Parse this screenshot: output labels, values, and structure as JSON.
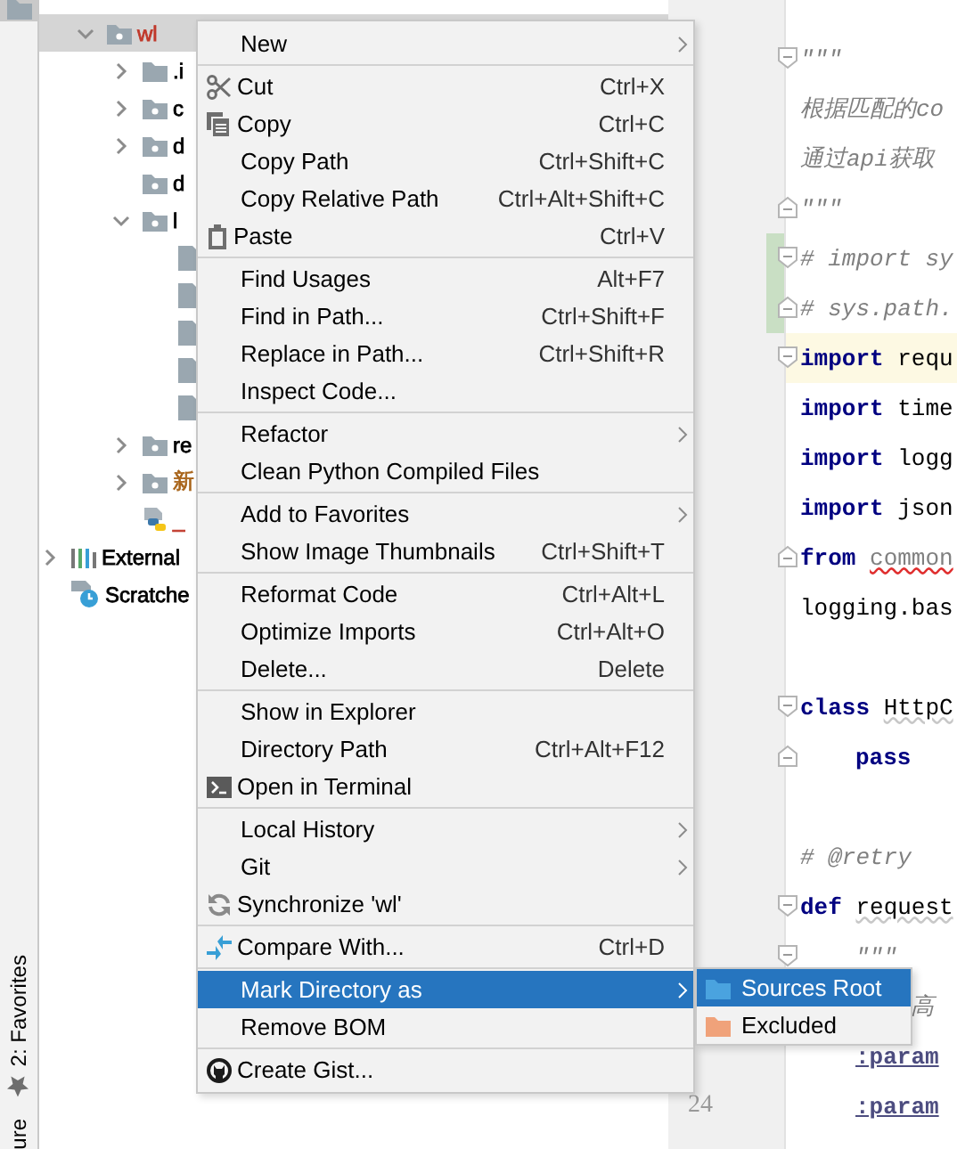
{
  "tool_strip": {
    "top_button": {
      "selected": true
    },
    "bottom_buttons": [
      {
        "label": "2: Favorites",
        "kind": "favorites"
      },
      {
        "label": "ure",
        "kind": "structure"
      }
    ]
  },
  "project_tree": {
    "items": [
      {
        "label": "wl",
        "kind": "package",
        "expanded": true,
        "selected": true,
        "color": "#c0392b",
        "children": [
          {
            "label": ".i",
            "kind": "folder",
            "expanded": false,
            "selected": false,
            "color": "#000000"
          },
          {
            "label": "c",
            "kind": "package",
            "expanded": false,
            "selected": false,
            "color": "#000000"
          },
          {
            "label": "d",
            "kind": "package",
            "expanded": false,
            "selected": false,
            "color": "#000000"
          },
          {
            "label": "d",
            "kind": "package",
            "selected": false,
            "color": "#000000"
          },
          {
            "label": "l",
            "kind": "package",
            "expanded": true,
            "selected": false,
            "color": "#000000",
            "children": [
              {
                "kind": "file",
                "selected": false
              },
              {
                "kind": "file",
                "selected": false
              },
              {
                "kind": "file",
                "selected": false
              },
              {
                "kind": "file",
                "selected": false
              },
              {
                "kind": "file",
                "selected": false
              }
            ]
          },
          {
            "label": "re",
            "kind": "package",
            "expanded": false,
            "selected": false,
            "color": "#000000"
          },
          {
            "label": "新",
            "kind": "package",
            "expanded": false,
            "selected": false,
            "color": "#a8641a"
          },
          {
            "label": "_",
            "kind": "python",
            "selected": false,
            "color": "#c0392b"
          }
        ]
      }
    ],
    "roots": [
      {
        "label": "External",
        "kind": "libraries",
        "expanded": false,
        "selected": false,
        "color": "#000000"
      },
      {
        "label": "Scratche",
        "kind": "scratches",
        "selected": false,
        "color": "#000000"
      }
    ]
  },
  "editor": {
    "lines": [
      {
        "kind": "top",
        "tokens": [
          {
            "text": "\"\"\"",
            "kind": "docstring"
          }
        ],
        "fold_start": true,
        "fold_end": false,
        "current": false,
        "changed": false
      },
      {
        "kind": "top",
        "tokens": [
          {
            "text": "根据匹配的co",
            "kind": "docstring"
          }
        ],
        "fold_start": false,
        "fold_end": false,
        "current": false,
        "changed": false
      },
      {
        "kind": "top",
        "tokens": [
          {
            "text": "通过api获取",
            "kind": "docstring"
          }
        ],
        "fold_start": false,
        "fold_end": false,
        "current": false,
        "changed": false
      },
      {
        "kind": "top",
        "tokens": [
          {
            "text": "\"\"\"",
            "kind": "docstring"
          }
        ],
        "fold_start": false,
        "fold_end": true,
        "current": false,
        "changed": false
      },
      {
        "kind": "top",
        "tokens": [
          {
            "text": "# import sy",
            "kind": "comment"
          }
        ],
        "fold_start": true,
        "fold_end": false,
        "current": false,
        "changed": true
      },
      {
        "kind": "top",
        "tokens": [
          {
            "text": "# sys.path.",
            "kind": "comment"
          }
        ],
        "fold_start": false,
        "fold_end": true,
        "current": false,
        "changed": true
      },
      {
        "kind": "top",
        "tokens": [
          {
            "text": "import",
            "kind": "keyword"
          },
          {
            "text": "requ",
            "kind": "plain"
          }
        ],
        "fold_start": true,
        "fold_end": false,
        "current": true,
        "changed": false
      },
      {
        "kind": "top",
        "tokens": [
          {
            "text": "import",
            "kind": "keyword"
          },
          {
            "text": "time",
            "kind": "plain"
          }
        ],
        "fold_start": false,
        "fold_end": false,
        "current": false,
        "changed": false
      },
      {
        "kind": "top",
        "tokens": [
          {
            "text": "import",
            "kind": "keyword"
          },
          {
            "text": "logg",
            "kind": "plain"
          }
        ],
        "fold_start": false,
        "fold_end": false,
        "current": false,
        "changed": false
      },
      {
        "kind": "top",
        "tokens": [
          {
            "text": "import",
            "kind": "keyword"
          },
          {
            "text": "json",
            "kind": "plain"
          }
        ],
        "fold_start": false,
        "fold_end": false,
        "current": false,
        "changed": false
      },
      {
        "kind": "top",
        "tokens": [
          {
            "text": "from",
            "kind": "keyword"
          },
          {
            "text": "common",
            "kind": "error"
          }
        ],
        "fold_start": false,
        "fold_end": true,
        "current": false,
        "changed": false
      },
      {
        "kind": "top",
        "tokens": [
          {
            "text": "logging.bas",
            "kind": "plain"
          }
        ],
        "fold_start": false,
        "fold_end": false,
        "current": false,
        "changed": false
      },
      {
        "kind": "top",
        "fold_start": false,
        "fold_end": false,
        "current": false,
        "changed": false
      },
      {
        "kind": "top",
        "tokens": [
          {
            "text": "class",
            "kind": "keyword"
          },
          {
            "text": "HttpC",
            "kind": "weak"
          }
        ],
        "fold_start": true,
        "fold_end": false,
        "current": false,
        "changed": false
      },
      {
        "kind": "block",
        "tokens": [
          {
            "text": "pass",
            "kind": "keyword"
          }
        ],
        "fold_start": false,
        "fold_end": true,
        "current": false,
        "changed": false
      },
      {
        "kind": "top",
        "fold_start": false,
        "fold_end": false,
        "current": false,
        "changed": false
      },
      {
        "kind": "top",
        "tokens": [
          {
            "text": "# @retry",
            "kind": "comment"
          }
        ],
        "fold_start": false,
        "fold_end": false,
        "current": false,
        "changed": false
      },
      {
        "kind": "top",
        "tokens": [
          {
            "text": "def",
            "kind": "keyword"
          },
          {
            "text": "request",
            "kind": "weak"
          }
        ],
        "fold_start": true,
        "fold_end": false,
        "current": false,
        "changed": false
      },
      {
        "kind": "block",
        "tokens": [
          {
            "text": "\"\"\"",
            "kind": "docstring"
          }
        ],
        "fold_start": true,
        "fold_end": false,
        "current": false,
        "changed": false
      },
      {
        "kind": "doc",
        "tokens": [
          {
            "text": "高",
            "kind": "docstring"
          }
        ],
        "fold_start": false,
        "fold_end": false,
        "current": false,
        "changed": false
      },
      {
        "kind": "block",
        "tokens": [
          {
            "text": ":param",
            "kind": "doctag"
          }
        ],
        "fold_start": false,
        "fold_end": false,
        "current": false,
        "changed": false
      },
      {
        "kind": "block",
        "number": "24",
        "tokens": [
          {
            "text": ":param",
            "kind": "doctag"
          }
        ],
        "fold_start": false,
        "fold_end": false,
        "current": false,
        "changed": false
      }
    ]
  },
  "context_menu": {
    "groups": [
      {
        "items": [
          {
            "label": "New",
            "kind": "plain",
            "submenu": true,
            "selected": false
          }
        ]
      },
      {
        "items": [
          {
            "label": "Cut",
            "shortcut": "Ctrl+X",
            "kind": "scissors",
            "submenu": false,
            "selected": false
          },
          {
            "label": "Copy",
            "shortcut": "Ctrl+C",
            "kind": "copy",
            "submenu": false,
            "selected": false
          },
          {
            "label": "Copy Path",
            "shortcut": "Ctrl+Shift+C",
            "kind": "plain",
            "submenu": false,
            "selected": false
          },
          {
            "label": "Copy Relative Path",
            "shortcut": "Ctrl+Alt+Shift+C",
            "kind": "plain",
            "submenu": false,
            "selected": false
          },
          {
            "label": "Paste",
            "shortcut": "Ctrl+V",
            "kind": "clipboard",
            "submenu": false,
            "selected": false
          }
        ]
      },
      {
        "items": [
          {
            "label": "Find Usages",
            "shortcut": "Alt+F7",
            "kind": "plain",
            "submenu": false,
            "selected": false
          },
          {
            "label": "Find in Path...",
            "shortcut": "Ctrl+Shift+F",
            "kind": "plain",
            "submenu": false,
            "selected": false
          },
          {
            "label": "Replace in Path...",
            "shortcut": "Ctrl+Shift+R",
            "kind": "plain",
            "submenu": false,
            "selected": false
          },
          {
            "label": "Inspect Code...",
            "kind": "plain",
            "submenu": false,
            "selected": false
          }
        ]
      },
      {
        "items": [
          {
            "label": "Refactor",
            "kind": "plain",
            "submenu": true,
            "selected": false
          },
          {
            "label": "Clean Python Compiled Files",
            "kind": "plain",
            "submenu": false,
            "selected": false
          }
        ]
      },
      {
        "items": [
          {
            "label": "Add to Favorites",
            "kind": "plain",
            "submenu": true,
            "selected": false
          },
          {
            "label": "Show Image Thumbnails",
            "shortcut": "Ctrl+Shift+T",
            "kind": "plain",
            "submenu": false,
            "selected": false
          }
        ]
      },
      {
        "items": [
          {
            "label": "Reformat Code",
            "shortcut": "Ctrl+Alt+L",
            "kind": "plain",
            "submenu": false,
            "selected": false
          },
          {
            "label": "Optimize Imports",
            "shortcut": "Ctrl+Alt+O",
            "kind": "plain",
            "submenu": false,
            "selected": false
          },
          {
            "label": "Delete...",
            "shortcut": "Delete",
            "kind": "plain",
            "submenu": false,
            "selected": false
          }
        ]
      },
      {
        "items": [
          {
            "label": "Show in Explorer",
            "kind": "plain",
            "submenu": false,
            "selected": false
          },
          {
            "label": "Directory Path",
            "shortcut": "Ctrl+Alt+F12",
            "kind": "plain",
            "submenu": false,
            "selected": false
          },
          {
            "label": "Open in Terminal",
            "kind": "terminal",
            "submenu": false,
            "selected": false
          }
        ]
      },
      {
        "items": [
          {
            "label": "Local History",
            "kind": "plain",
            "submenu": true,
            "selected": false
          },
          {
            "label": "Git",
            "kind": "plain",
            "submenu": true,
            "selected": false
          },
          {
            "label": "Synchronize 'wl'",
            "kind": "sync",
            "submenu": false,
            "selected": false
          }
        ]
      },
      {
        "items": [
          {
            "label": "Compare With...",
            "shortcut": "Ctrl+D",
            "kind": "compare",
            "submenu": false,
            "selected": false
          }
        ]
      },
      {
        "items": [
          {
            "label": "Mark Directory as",
            "kind": "plain",
            "submenu": true,
            "selected": true
          },
          {
            "label": "Remove BOM",
            "kind": "plain",
            "submenu": false,
            "selected": false
          }
        ]
      },
      {
        "items": [
          {
            "label": "Create Gist...",
            "kind": "cat",
            "submenu": false,
            "selected": false
          }
        ]
      }
    ]
  },
  "submenu": {
    "items": [
      {
        "label": "Sources Root",
        "kind": "sources",
        "selected": true
      },
      {
        "label": "Excluded",
        "kind": "excluded",
        "selected": false
      }
    ]
  }
}
